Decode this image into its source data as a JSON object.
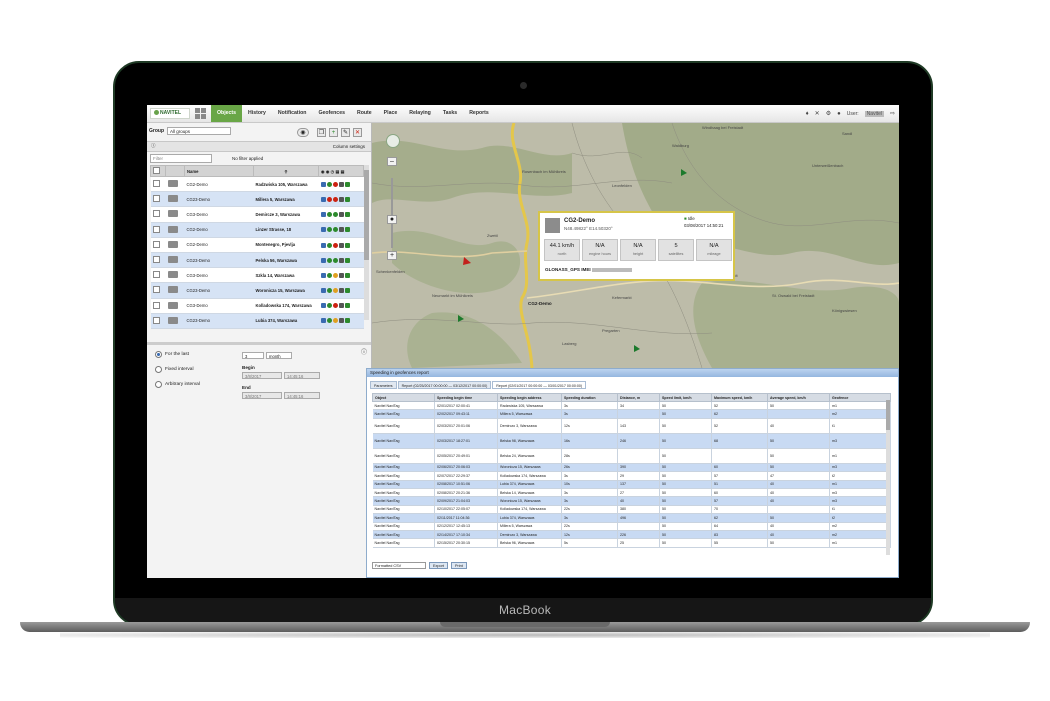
{
  "device": {
    "brand": "MacBook"
  },
  "app": {
    "logo": "NAVITEL",
    "menu": [
      "Objects",
      "History",
      "Notification",
      "Geofences",
      "Route",
      "Place",
      "Relaying",
      "Tasks",
      "Reports"
    ],
    "active_menu": "Objects",
    "user_label": "User:",
    "user_name": "Navitel"
  },
  "left": {
    "group_label": "Group",
    "group_value": "All groups",
    "column_settings": "Column settings",
    "filter_placeholder": "Filter",
    "filter_status": "No filter applied",
    "table_header": "Name",
    "objects": [
      {
        "name": "CG2-Demo",
        "address": "Radzwiska 105, Warszawa"
      },
      {
        "name": "CG23-Demo",
        "address": "Millera 5, Warszawa"
      },
      {
        "name": "CG3-Demo",
        "address": "Demircze 3, Warszawa"
      },
      {
        "name": "CG2-Demo",
        "address": "Linzer Strasse, 18"
      },
      {
        "name": "CG2-Demo",
        "address": "Montenegro, Pjevlja"
      },
      {
        "name": "CG23-Demo",
        "address": "Pelska 56, Warszawa"
      },
      {
        "name": "CG3-Demo",
        "address": "Szkla 14, Warszawa"
      },
      {
        "name": "CG23-Demo",
        "address": "Woronicza 15, Warszawa"
      },
      {
        "name": "CG3-Demo",
        "address": "Kolladowska 174, Warszawa"
      },
      {
        "name": "CG23-Demo",
        "address": "Lubia 374, Warszawa"
      }
    ],
    "period": {
      "for_last": "For the last",
      "for_last_value": "3",
      "for_last_unit": "month",
      "fixed": "Fixed interval",
      "arbitrary": "Arbitrary interval",
      "begin_label": "Begin",
      "begin_date": "3/8/2017",
      "begin_time": "14:45:16",
      "end_label": "End",
      "end_date": "3/8/2017",
      "end_time": "14:45:16"
    }
  },
  "map": {
    "popup": {
      "title": "CG2-Demo",
      "coords": "N48.49822° E14.50320°",
      "status": "Idle",
      "datetime": "03/08/2017 14:50:21",
      "stats": [
        {
          "value": "44.1 km/h",
          "unit": "north"
        },
        {
          "value": "N/A",
          "unit": "engine hours"
        },
        {
          "value": "N/A",
          "unit": "height"
        },
        {
          "value": "5",
          "unit": "satellites"
        },
        {
          "value": "N/A",
          "unit": "mileage"
        }
      ],
      "gps": "GLONASS_GPS IMEI"
    },
    "car_label": "CG2-Demo",
    "places": [
      "Rosenbach im Mühlkreis",
      "Leonfelden",
      "Freistadt",
      "Schenkenfelden",
      "Zwettl",
      "Waldburg",
      "Neumarkt im Mühlkreis",
      "Pregarten",
      "Lasberg",
      "Kefermarkt",
      "Unterweißenbach",
      "Königswiesen",
      "Sandl",
      "St. Oswald bei Freistadt",
      "Windhaag bei Freistadt"
    ]
  },
  "report": {
    "title": "Speeding in geofences report",
    "tabs": [
      "Parameters",
      "Report (02/25/2017 00:00:00 — 03/12/2017 00:00:00)",
      "Report (02/01/2017 00:00:00 — 03/01/2017 00:00:00)"
    ],
    "columns": [
      "Object",
      "Speeding begin time",
      "Speeding begin address",
      "Speeding duration",
      "Distance, m",
      "Speed limit, km/h",
      "Maximum speed, km/h",
      "Average speed, km/h",
      "Geofence"
    ],
    "rows": [
      [
        "Navitel NaviTag",
        "02/01/2017 02:00:41",
        "Radzwiska 105, Warszawa",
        "3s",
        "34",
        "50",
        "52",
        "50",
        "m1"
      ],
      [
        "Navitel NaviTag",
        "02/02/2017 09:43:11",
        "Millera 5, Warszawa",
        "3s",
        "",
        "50",
        "62",
        "",
        "m2"
      ],
      [
        "Navitel NaviTag",
        "02/03/2017 20:01:06",
        "Demirczo 3, Warszawa",
        "12s",
        "143",
        "50",
        "52",
        "40",
        "t1"
      ],
      [
        "Navitel NaviTag",
        "02/03/2017 18:27:01",
        "Belska 98, Warszawa",
        "16s",
        "246",
        "50",
        "68",
        "50",
        "m3"
      ],
      [
        "Navitel NaviTag",
        "02/05/2017 20:49:01",
        "Belska 24, Warszawa",
        "28s",
        "",
        "50",
        "",
        "50",
        "m1"
      ],
      [
        "Navitel NaviTag",
        "02/06/2017 20:06:03",
        "Woronicza 15, Warszawa",
        "26s",
        "390",
        "50",
        "60",
        "50",
        "m3"
      ],
      [
        "Navitel NaviTag",
        "02/07/2017 22:29:37",
        "Kolladowska 174, Warszawa",
        "3s",
        "29",
        "50",
        "57",
        "47",
        "t2"
      ],
      [
        "Navitel NaviTag",
        "02/08/2017 10:51:06",
        "Lubia 374, Warszawa",
        "10s",
        "137",
        "50",
        "51",
        "40",
        "m1"
      ],
      [
        "Navitel NaviTag",
        "02/08/2017 20:21:36",
        "Belska 14, Warszawa",
        "3s",
        "27",
        "50",
        "60",
        "40",
        "m3"
      ],
      [
        "Navitel NaviTag",
        "02/09/2017 21:04:03",
        "Woronicza 15, Warszawa",
        "3s",
        "40",
        "50",
        "57",
        "40",
        "m3"
      ],
      [
        "Navitel NaviTag",
        "02/10/2017 22:05:07",
        "Kolladowska 174, Warszawa",
        "22s",
        "380",
        "50",
        "70",
        "",
        "t1"
      ],
      [
        "Navitel NaviTag",
        "02/11/2017 11:04:36",
        "Lubia 374, Warszawa",
        "3s",
        "496",
        "50",
        "62",
        "50",
        "t2"
      ],
      [
        "Navitel NaviTag",
        "02/12/2017 12:45:13",
        "Millera 5, Warszawa",
        "22s",
        "",
        "50",
        "64",
        "40",
        "m2"
      ],
      [
        "Navitel NaviTag",
        "02/14/2017 17:10:34",
        "Demirczo 3, Warszawa",
        "12s",
        "226",
        "50",
        "83",
        "40",
        "m2"
      ],
      [
        "Navitel NaviTag",
        "02/15/2017 20:30:15",
        "Belska 96, Warszawa",
        "5s",
        "25",
        "50",
        "55",
        "50",
        "m1"
      ]
    ],
    "format": "Formatted CSV",
    "export_btn": "Export",
    "print_btn": "Print"
  }
}
